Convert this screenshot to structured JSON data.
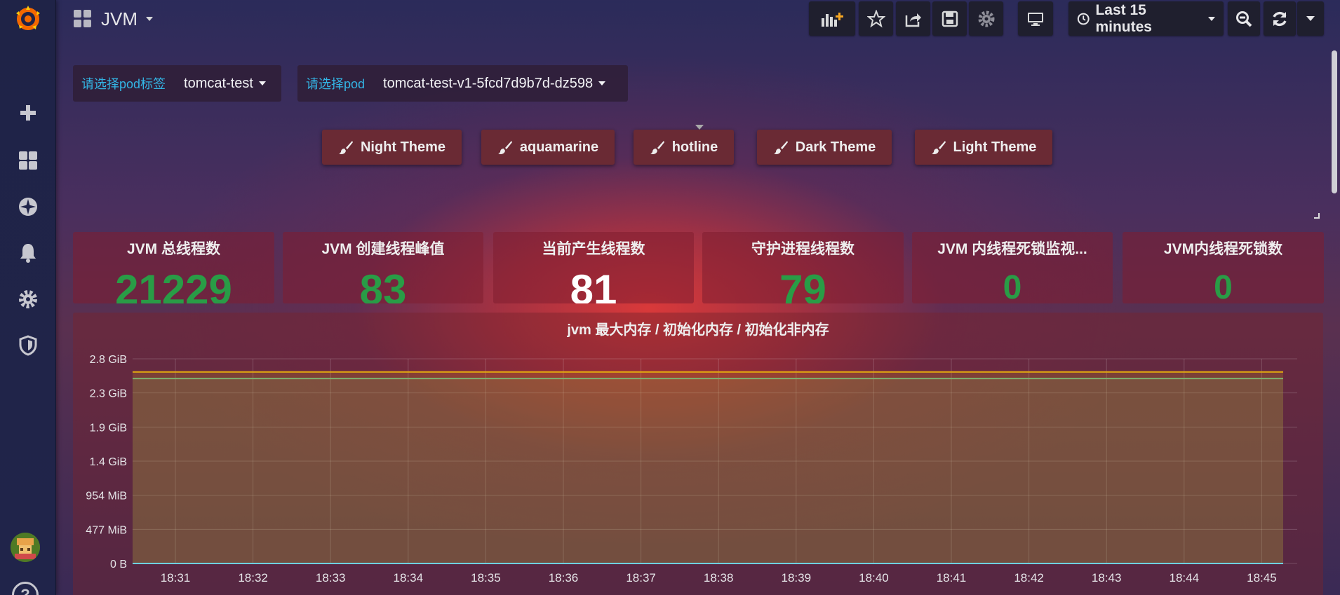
{
  "dashboard": {
    "title": "JVM"
  },
  "toolbar": {
    "time_range": "Last 15 minutes"
  },
  "variables": [
    {
      "label": "请选择pod标签",
      "value": "tomcat-test"
    },
    {
      "label": "请选择pod",
      "value": "tomcat-test-v1-5fcd7d9b7d-dz598"
    }
  ],
  "themes": [
    "Night Theme",
    "aquamarine",
    "hotline",
    "Dark Theme",
    "Light Theme"
  ],
  "stats": [
    {
      "title": "JVM 总线程数",
      "value": "21229",
      "color": "#299c46"
    },
    {
      "title": "JVM 创建线程峰值",
      "value": "83",
      "color": "#299c46"
    },
    {
      "title": "当前产生线程数",
      "value": "81",
      "color": "#ffffff"
    },
    {
      "title": "守护进程线程数",
      "value": "79",
      "color": "#299c46"
    },
    {
      "title": "JVM 内线程死锁监视...",
      "value": "0",
      "color": "#299c46"
    },
    {
      "title": "JVM内线程死锁数",
      "value": "0",
      "color": "#299c46"
    }
  ],
  "graph": {
    "title": "jvm 最大内存 / 初始化内存 / 初始化非内存"
  },
  "chart_data": {
    "type": "line",
    "y_ticks": [
      "2.8 GiB",
      "2.3 GiB",
      "1.9 GiB",
      "1.4 GiB",
      "954 MiB",
      "477 MiB",
      "0 B"
    ],
    "x_ticks": [
      "18:31",
      "18:32",
      "18:33",
      "18:34",
      "18:35",
      "18:36",
      "18:37",
      "18:38",
      "18:39",
      "18:40",
      "18:41",
      "18:42",
      "18:43",
      "18:44",
      "18:45"
    ],
    "ylim_gib": [
      0,
      2.8
    ],
    "grid": true,
    "series": [
      {
        "y_gib": 2.62,
        "color": "#e5ac0e"
      },
      {
        "y_gib": 2.53,
        "color": "#7eb26d"
      },
      {
        "y_gib": 0.0,
        "color": "#6ed0e0"
      }
    ]
  },
  "colors": {
    "accent_link": "#33b5e5",
    "stat_green": "#299c46",
    "sidebar_bg": "#1f2347"
  }
}
